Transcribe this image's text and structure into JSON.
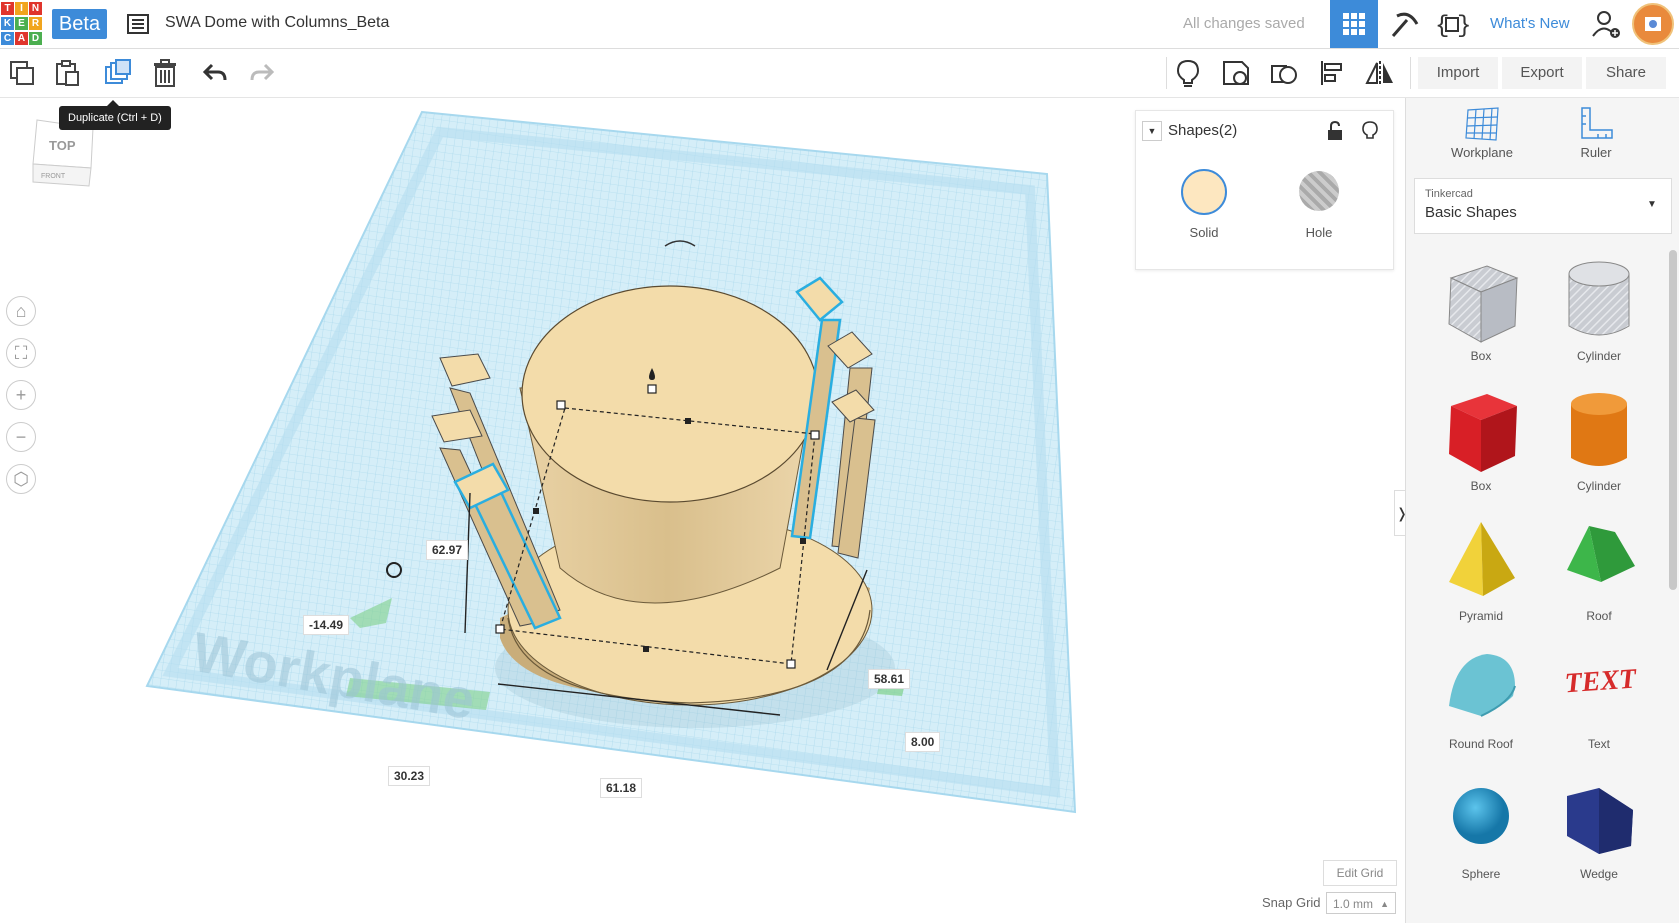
{
  "header": {
    "logo_letters": [
      "T",
      "I",
      "N",
      "K",
      "E",
      "R",
      "C",
      "A",
      "D"
    ],
    "beta": "Beta",
    "project_title": "SWA Dome with Columns_Beta",
    "save_status": "All changes saved",
    "whats_new": "What's New"
  },
  "toolbar": {
    "tooltip": "Duplicate (Ctrl + D)",
    "import": "Import",
    "export": "Export",
    "share": "Share"
  },
  "viewcube": {
    "top": "TOP",
    "front": "FRONT"
  },
  "shapes_panel": {
    "title": "Shapes(2)",
    "solid": "Solid",
    "hole": "Hole",
    "solid_color": "#fde7c0"
  },
  "workplane": {
    "label": "Workplane",
    "dims": {
      "d1": "62.97",
      "d2": "-14.49",
      "d3": "30.23",
      "d4": "61.18",
      "d5": "58.61",
      "d6": "8.00"
    },
    "edit_grid": "Edit Grid",
    "snap_grid_label": "Snap Grid",
    "snap_grid_value": "1.0 mm"
  },
  "right_panel": {
    "workplane": "Workplane",
    "ruler": "Ruler",
    "library_category": "Tinkercad",
    "library_name": "Basic Shapes",
    "shapes": [
      "Box",
      "Cylinder",
      "Box",
      "Cylinder",
      "Pyramid",
      "Roof",
      "Round Roof",
      "Text",
      "Sphere",
      "Wedge"
    ]
  },
  "colors": {
    "accent": "#3d8bd9",
    "grid": "#bfe4f2",
    "solid": "#f3dcaa"
  }
}
